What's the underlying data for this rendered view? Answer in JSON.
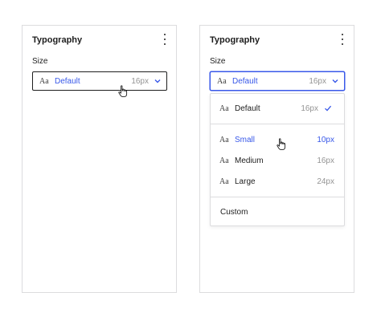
{
  "left_panel": {
    "title": "Typography",
    "size_label": "Size",
    "select": {
      "icon": "Aa",
      "value": "Default",
      "size": "16px"
    }
  },
  "right_panel": {
    "title": "Typography",
    "size_label": "Size",
    "select": {
      "icon": "Aa",
      "value": "Default",
      "size": "16px"
    },
    "options": [
      {
        "icon": "Aa",
        "label": "Default",
        "size": "16px",
        "selected": true
      },
      {
        "icon": "Aa",
        "label": "Small",
        "size": "10px",
        "hovered": true
      },
      {
        "icon": "Aa",
        "label": "Medium",
        "size": "16px"
      },
      {
        "icon": "Aa",
        "label": "Large",
        "size": "24px"
      }
    ],
    "custom_label": "Custom"
  },
  "colors": {
    "accent": "#3858e9",
    "muted": "#949494",
    "border": "#dcdcde",
    "text": "#1e1e1e"
  },
  "icons": [
    "more-vertical-icon",
    "chevron-down-icon",
    "check-icon",
    "hand-pointer-cursor-icon"
  ]
}
